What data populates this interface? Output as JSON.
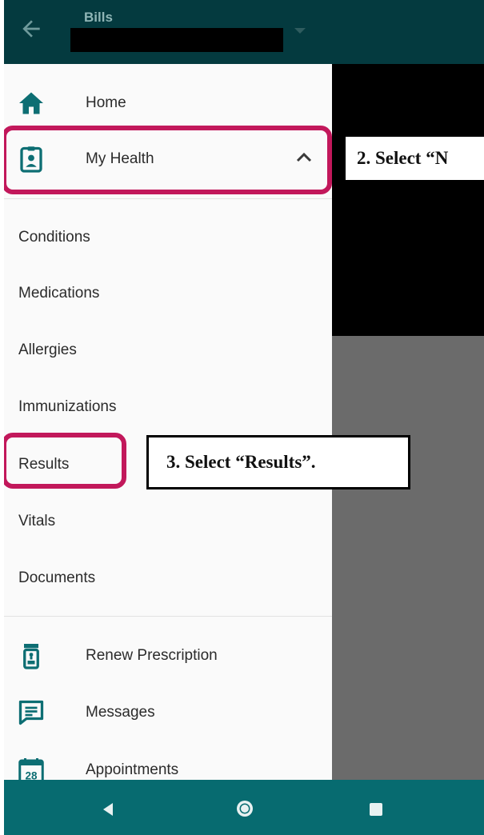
{
  "topbar": {
    "title": "Bills"
  },
  "drawer": {
    "primary": [
      {
        "label": "Home",
        "icon": "home-icon"
      },
      {
        "label": "My Health",
        "icon": "health-badge-icon"
      }
    ],
    "submenu": [
      {
        "label": "Conditions"
      },
      {
        "label": "Medications"
      },
      {
        "label": "Allergies"
      },
      {
        "label": "Immunizations"
      },
      {
        "label": "Results"
      },
      {
        "label": "Vitals"
      },
      {
        "label": "Documents"
      }
    ],
    "secondary": [
      {
        "label": "Renew Prescription",
        "icon": "prescription-bottle-icon"
      },
      {
        "label": "Messages",
        "icon": "message-icon"
      },
      {
        "label": "Appointments",
        "icon": "calendar-icon",
        "calendar_day": "28"
      }
    ]
  },
  "annotations": {
    "step2": "2.  Select “N",
    "step3": "3.  Select “Results”."
  },
  "colors": {
    "brand_dark": "#043a3f",
    "accent": "#076b70",
    "icon": "#0d6e73",
    "highlight": "#c2185b"
  }
}
